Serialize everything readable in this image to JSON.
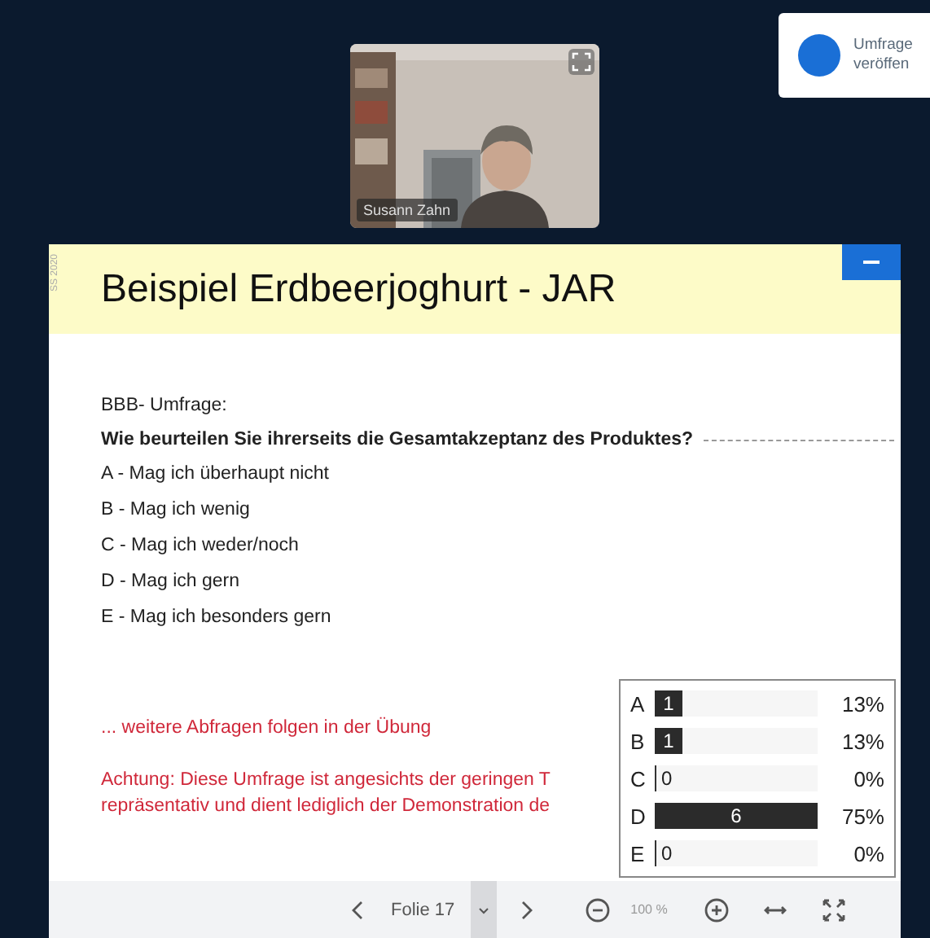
{
  "toast": {
    "lines": [
      "Umfrage",
      "veröffen"
    ]
  },
  "video": {
    "name": "Susann Zahn"
  },
  "slide": {
    "side_label": "SS 2020",
    "title": "Beispiel Erdbeerjoghurt - JAR",
    "intro": "BBB- Umfrage:",
    "question": "Wie beurteilen Sie ihrerseits die Gesamtakzeptanz des Produktes?",
    "options": [
      "A - Mag ich überhaupt nicht",
      "B - Mag ich wenig",
      "C - Mag ich weder/noch",
      "D - Mag ich gern",
      "E - Mag ich besonders gern"
    ],
    "note": "... weitere Abfragen folgen in der Übung",
    "warning": [
      "Achtung: Diese Umfrage ist angesichts der geringen T",
      "repräsentativ und dient lediglich der Demonstration de"
    ]
  },
  "poll_results": [
    {
      "letter": "A",
      "count": "1",
      "level": 0.17,
      "percent": "13%"
    },
    {
      "letter": "B",
      "count": "1",
      "level": 0.17,
      "percent": "13%"
    },
    {
      "letter": "C",
      "count": "0",
      "level": 0,
      "percent": "0%"
    },
    {
      "letter": "D",
      "count": "6",
      "level": 1,
      "percent": "75%"
    },
    {
      "letter": "E",
      "count": "0",
      "level": 0,
      "percent": "0%"
    }
  ],
  "toolbar": {
    "slide_label": "Folie 17",
    "zoom": "100 %"
  }
}
